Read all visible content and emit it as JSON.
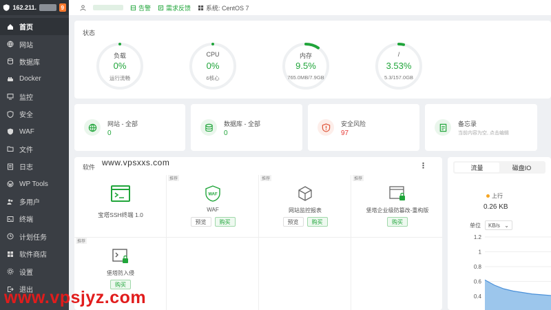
{
  "header": {
    "ip": "162.211.",
    "badge": "9"
  },
  "sidebar": {
    "items": [
      {
        "label": "首页",
        "icon": "home-icon"
      },
      {
        "label": "网站",
        "icon": "globe-icon"
      },
      {
        "label": "数据库",
        "icon": "database-icon"
      },
      {
        "label": "Docker",
        "icon": "docker-icon"
      },
      {
        "label": "监控",
        "icon": "monitor-icon"
      },
      {
        "label": "安全",
        "icon": "shield-icon"
      },
      {
        "label": "WAF",
        "icon": "waf-icon"
      },
      {
        "label": "文件",
        "icon": "folder-icon"
      },
      {
        "label": "日志",
        "icon": "log-icon"
      },
      {
        "label": "WP Tools",
        "icon": "wordpress-icon"
      },
      {
        "label": "多用户",
        "icon": "users-icon"
      },
      {
        "label": "终端",
        "icon": "terminal-icon"
      },
      {
        "label": "计划任务",
        "icon": "clock-icon"
      },
      {
        "label": "软件商店",
        "icon": "store-icon"
      },
      {
        "label": "设置",
        "icon": "gear-icon"
      },
      {
        "label": "退出",
        "icon": "logout-icon"
      }
    ]
  },
  "topbar": {
    "alert": "告警",
    "feedback": "需求反馈",
    "system": "系统: CentOS 7"
  },
  "status": {
    "title": "状态",
    "gauges": [
      {
        "label": "负载",
        "value": "0%",
        "sub": "运行流畅",
        "percent": 0
      },
      {
        "label": "CPU",
        "value": "0%",
        "sub": "6核心",
        "percent": 0
      },
      {
        "label": "内存",
        "value": "9.5%",
        "sub": "765.0MB/7.9GB",
        "percent": 9.5
      },
      {
        "label": "/",
        "value": "3.53%",
        "sub": "5.3/157.0GB",
        "percent": 3.53
      }
    ],
    "accent": "#20a53a"
  },
  "summary": [
    {
      "title": "网站 - 全部",
      "value": "0",
      "icon": "globe-icon"
    },
    {
      "title": "数据库 - 全部",
      "value": "0",
      "icon": "database-icon"
    },
    {
      "title": "安全风险",
      "value": "97",
      "icon": "shield-alert-icon"
    },
    {
      "title": "备忘录",
      "desc": "当前内容为空, 点击编辑",
      "icon": "memo-icon"
    }
  ],
  "software": {
    "title": "软件",
    "watermark": "www.vpsxxs.com",
    "tag": "推荐",
    "items": [
      {
        "name": "宝塔SSH终端 1.0",
        "icon": "terminal-app-icon",
        "buttons": []
      },
      {
        "name": "WAF",
        "icon": "waf-app-icon",
        "buttons": [
          "预览",
          "购买"
        ]
      },
      {
        "name": "网站监控报表",
        "icon": "cube-icon",
        "buttons": [
          "预览",
          "购买"
        ]
      },
      {
        "name": "堡塔企业级防篡改-重构版",
        "icon": "lock-window-icon",
        "buttons": [
          "购买"
        ]
      },
      {
        "name": "堡塔防入侵",
        "icon": "intrusion-icon",
        "buttons": [
          "购买"
        ]
      }
    ]
  },
  "traffic": {
    "tabs": [
      "流量",
      "磁盘IO"
    ],
    "upload_label": "上行",
    "upload_value": "0.26 KB",
    "unit_label": "单位",
    "unit_value": "KB/s",
    "chart_data": {
      "type": "area",
      "y_ticks": [
        "1.2",
        "1",
        "0.8",
        "0.6",
        "0.4"
      ],
      "ylim": [
        0.4,
        1.2
      ],
      "values": [
        0.62,
        0.55,
        0.5,
        0.47,
        0.45,
        0.43,
        0.42,
        0.41
      ]
    }
  },
  "watermark_bottom": "www.vpsjyz.com"
}
